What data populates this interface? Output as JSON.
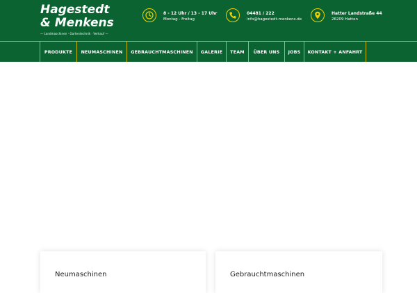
{
  "logo": {
    "line1": "Hagestedt",
    "line2": "& Menkens",
    "tagline": "— Landmaschinen · Gartentechnik · Verkauf —"
  },
  "info": {
    "hours": {
      "icon": "clock-icon",
      "line1": "8 - 12 Uhr / 13 - 17 Uhr",
      "line2": "Montag - Freitag"
    },
    "phone": {
      "icon": "phone-icon",
      "line1": "04481 / 222",
      "line2": "info@hagestedt-menkens.de"
    },
    "address": {
      "icon": "map-pin-icon",
      "line1": "Hatter Landstraße 44",
      "line2": "26209 Hatten"
    }
  },
  "nav": {
    "items": [
      {
        "label": "PRODUKTE"
      },
      {
        "label": "NEUMASCHINEN"
      },
      {
        "label": "GEBRAUCHTMASCHINEN"
      },
      {
        "label": "GALERIE"
      },
      {
        "label": "TEAM"
      },
      {
        "label": "ÜBER UNS"
      },
      {
        "label": "JOBS"
      },
      {
        "label": "KONTAKT + ANFAHRT"
      }
    ]
  },
  "cards": {
    "neu": {
      "title": "Neumaschinen"
    },
    "gebraucht": {
      "title": "Gebrauchtmaschinen"
    }
  },
  "colors": {
    "brand_green": "#0b6332",
    "accent_yellow": "#f0d200",
    "nav_divider": "#c9b400"
  }
}
